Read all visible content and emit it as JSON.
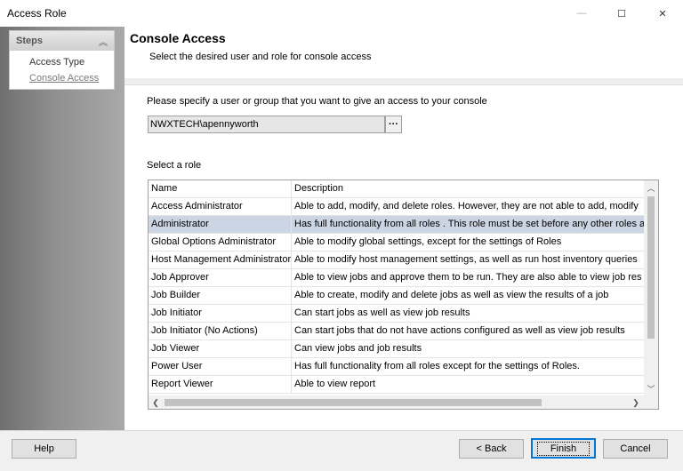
{
  "window": {
    "title": "Access Role",
    "minimize_glyph": "—",
    "maximize_glyph": "☐",
    "close_glyph": "✕"
  },
  "steps": {
    "header": "Steps",
    "collapse_glyph": "︽",
    "items": [
      {
        "label": "Access Type",
        "state": "completed"
      },
      {
        "label": "Console Access",
        "state": "current"
      }
    ]
  },
  "page": {
    "title": "Console Access",
    "subtitle": "Select the desired user and role for console access"
  },
  "user_section": {
    "prompt": "Please specify a user or group that you want to give an access to your console",
    "value": "NWXTECH\\apennyworth",
    "browse_label": "···"
  },
  "roles": {
    "label": "Select a role",
    "columns": [
      "Name",
      "Description"
    ],
    "selected_index": 1,
    "rows": [
      {
        "name": "Access Administrator",
        "desc": "Able to add, modify, and delete roles.  However, they are not able to add, modify"
      },
      {
        "name": "Administrator",
        "desc": "Has full functionality from all roles .  This role must be set before any other roles a"
      },
      {
        "name": "Global Options Administrator",
        "desc": "Able to modify global settings, except for the settings of Roles"
      },
      {
        "name": "Host Management Administrator",
        "desc": "Able to modify host management settings, as well as run host inventory queries"
      },
      {
        "name": "Job Approver",
        "desc": "Able to view jobs and approve them to be run.  They are also able to view job res"
      },
      {
        "name": "Job Builder",
        "desc": "Able to create, modify and delete jobs as well as view the results of a job"
      },
      {
        "name": "Job Initiator",
        "desc": "Can start jobs as well as view job results"
      },
      {
        "name": "Job Initiator (No Actions)",
        "desc": "Can start jobs that do not have actions configured as well as view job results"
      },
      {
        "name": "Job Viewer",
        "desc": "Can view jobs and job results"
      },
      {
        "name": "Power User",
        "desc": "Has full functionality from all roles except for the settings of Roles."
      },
      {
        "name": "Report Viewer",
        "desc": "Able to view report"
      }
    ],
    "scroll_up_glyph": "︿",
    "scroll_down_glyph": "﹀",
    "scroll_left_glyph": "❮",
    "scroll_right_glyph": "❯"
  },
  "footer": {
    "help": "Help",
    "back": "< Back",
    "finish": "Finish",
    "cancel": "Cancel"
  },
  "colors": {
    "selection": "#cbd5e3",
    "default_button_border": "#0078d7"
  }
}
